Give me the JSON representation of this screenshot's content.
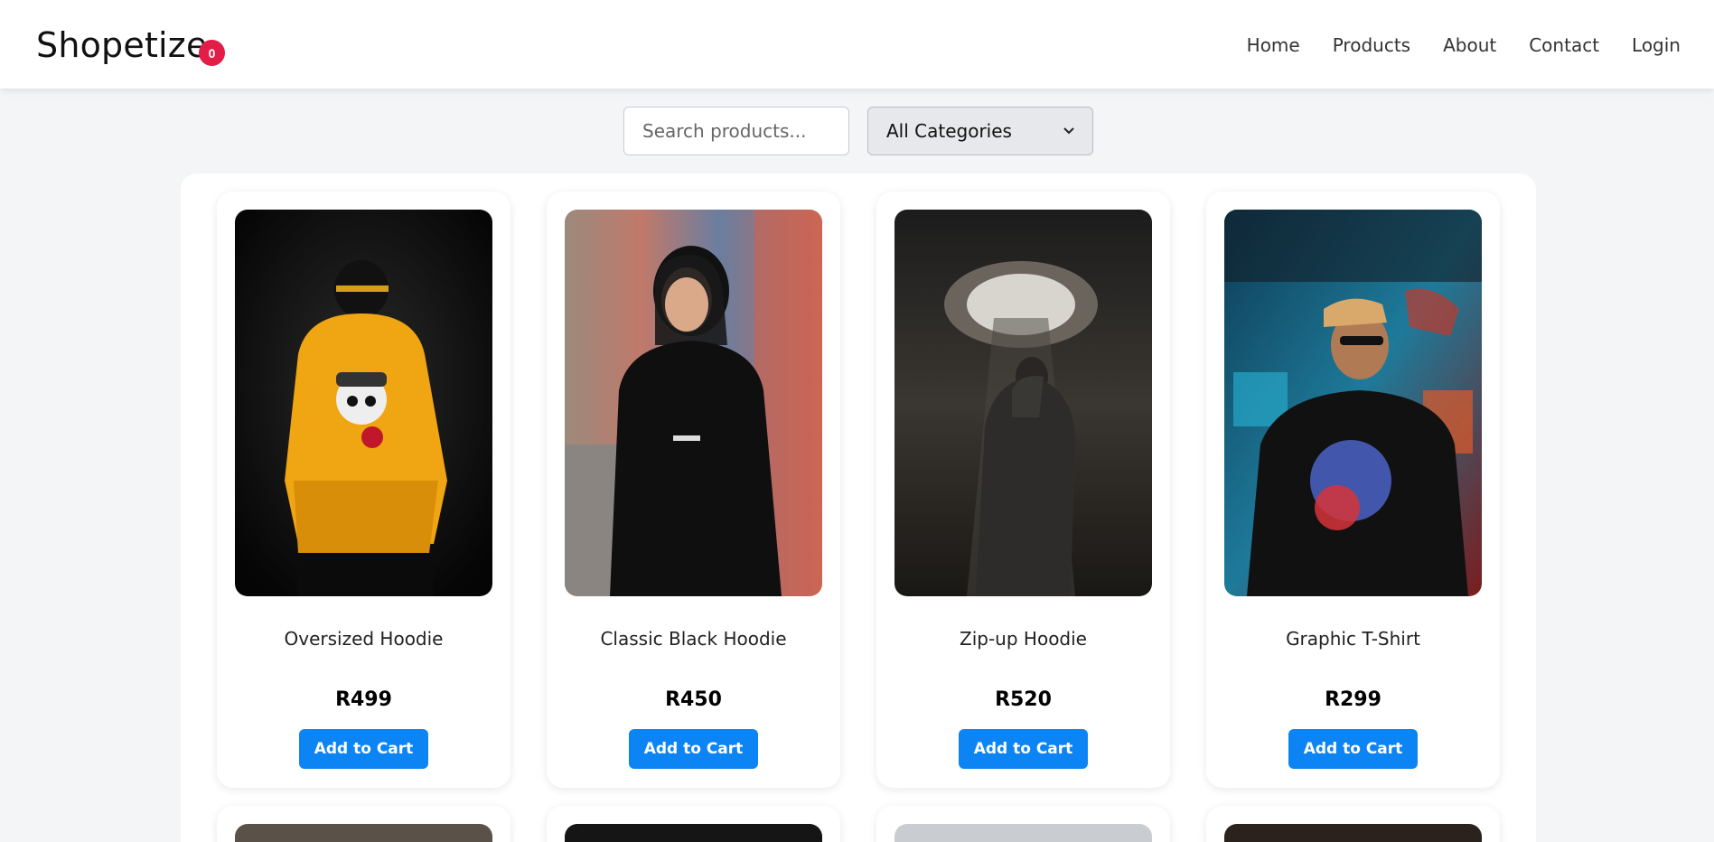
{
  "header": {
    "brand": "Shopetize",
    "cart_count": "0",
    "nav": [
      "Home",
      "Products",
      "About",
      "Contact",
      "Login"
    ]
  },
  "filters": {
    "search_placeholder": "Search products...",
    "category_selected": "All Categories"
  },
  "products": [
    {
      "name": "Oversized Hoodie",
      "price": "R499",
      "button": "Add to Cart",
      "image": "person-yellow-hoodie-photo"
    },
    {
      "name": "Classic Black Hoodie",
      "price": "R450",
      "button": "Add to Cart",
      "image": "woman-black-hoodie-photo"
    },
    {
      "name": "Zip-up Hoodie",
      "price": "R520",
      "button": "Add to Cart",
      "image": "person-grey-hoodie-photo"
    },
    {
      "name": "Graphic T-Shirt",
      "price": "R299",
      "button": "Add to Cart",
      "image": "man-graphic-tshirt-photo"
    }
  ],
  "colors": {
    "accent": "#0d84f4",
    "badge": "#e11d48",
    "background": "#f4f5f7"
  }
}
